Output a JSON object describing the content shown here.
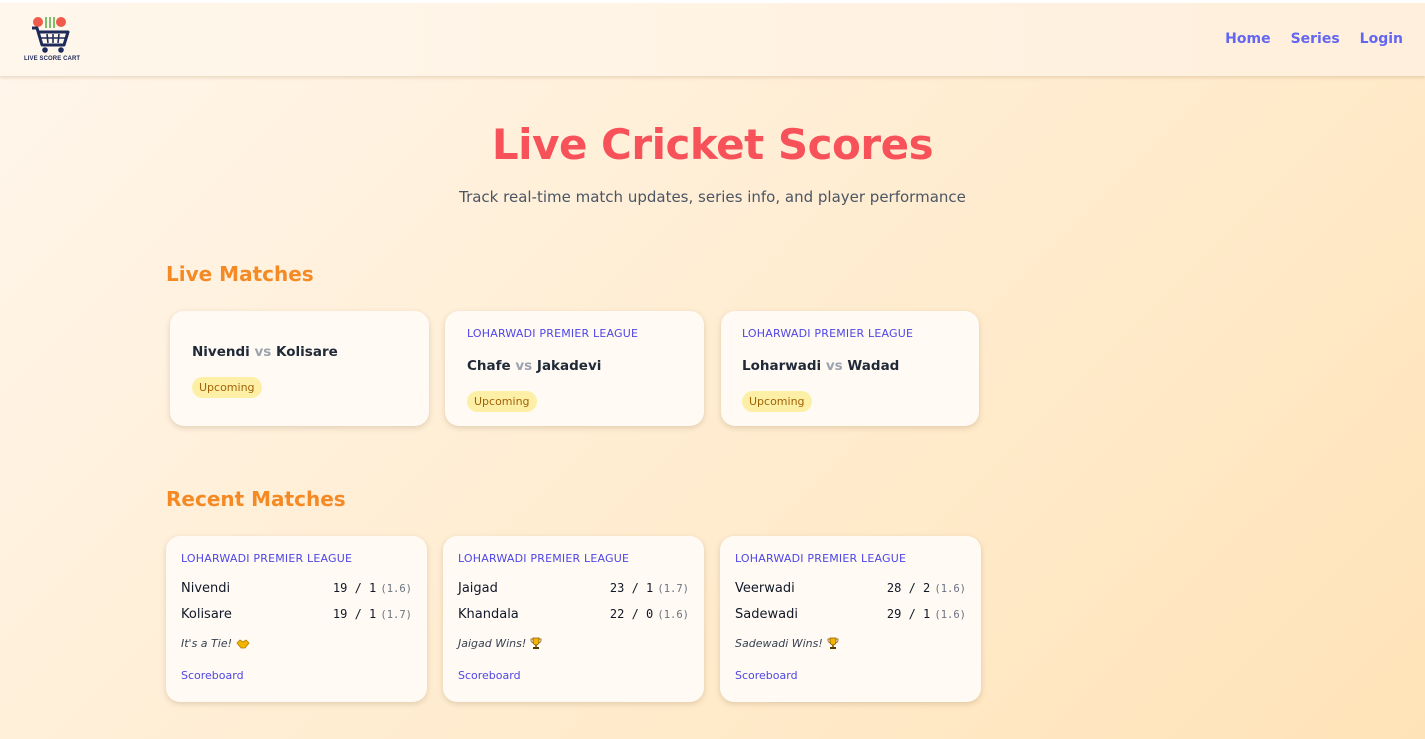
{
  "nav": {
    "logo_text": "LIVE SCORE CART",
    "links": [
      "Home",
      "Series",
      "Login"
    ]
  },
  "hero": {
    "title": "Live Cricket Scores",
    "subtitle": "Track real-time match updates, series info, and player performance"
  },
  "live": {
    "heading": "Live Matches",
    "matches": [
      {
        "league": "",
        "team1": "Nivendi",
        "vs": "vs",
        "team2": "Kolisare",
        "status": "Upcoming"
      },
      {
        "league": "LOHARWADI PREMIER LEAGUE",
        "team1": "Chafe",
        "vs": "vs",
        "team2": "Jakadevi",
        "status": "Upcoming"
      },
      {
        "league": "LOHARWADI PREMIER LEAGUE",
        "team1": "Loharwadi",
        "vs": "vs",
        "team2": "Wadad",
        "status": "Upcoming"
      }
    ]
  },
  "recent": {
    "heading": "Recent Matches",
    "matches": [
      {
        "league": "LOHARWADI PREMIER LEAGUE",
        "team1": {
          "name": "Nivendi",
          "score": "19 / 1",
          "overs": "(1.6)"
        },
        "team2": {
          "name": "Kolisare",
          "score": "19 / 1",
          "overs": "(1.7)"
        },
        "result": "It's a Tie!",
        "result_icon": "handshake-icon",
        "link": "Scoreboard"
      },
      {
        "league": "LOHARWADI PREMIER LEAGUE",
        "team1": {
          "name": "Jaigad",
          "score": "23 / 1",
          "overs": "(1.7)"
        },
        "team2": {
          "name": "Khandala",
          "score": "22 / 0",
          "overs": "(1.6)"
        },
        "result": "Jaigad Wins!",
        "result_icon": "trophy-icon",
        "link": "Scoreboard"
      },
      {
        "league": "LOHARWADI PREMIER LEAGUE",
        "team1": {
          "name": "Veerwadi",
          "score": "28 / 2",
          "overs": "(1.6)"
        },
        "team2": {
          "name": "Sadewadi",
          "score": "29 / 1",
          "overs": "(1.6)"
        },
        "result": "Sadewadi Wins!",
        "result_icon": "trophy-icon",
        "link": "Scoreboard"
      }
    ]
  },
  "colors": {
    "accent": "#f7525a",
    "section": "#f58a24",
    "link": "#6366f1",
    "badge_bg": "#fdf0a6",
    "badge_text": "#a16207"
  }
}
